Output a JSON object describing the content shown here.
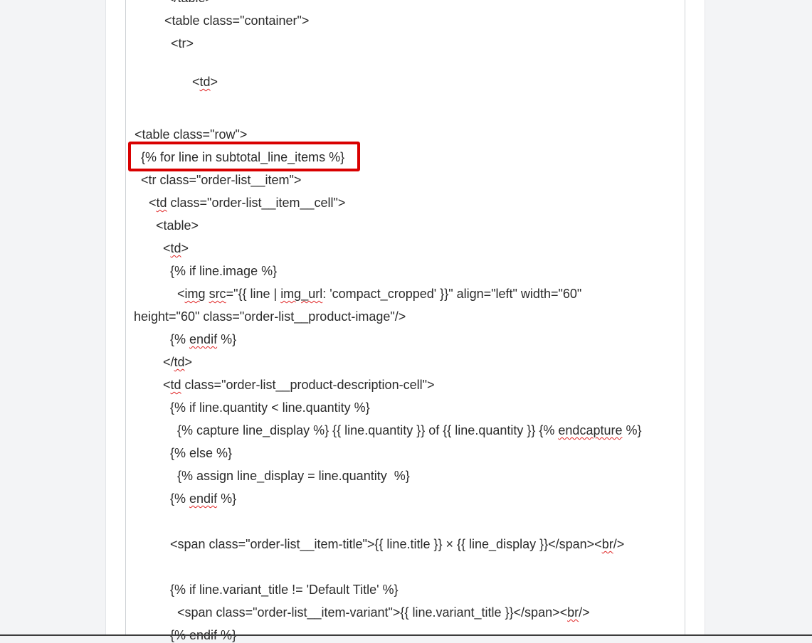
{
  "editor": {
    "lines": [
      "</table>",
      "<table class=\"container\">",
      "  <tr>",
      "    <td>",
      "",
      "",
      "<table class=\"row\">",
      "  {% for line in subtotal_line_items %}",
      "  <tr class=\"order-list__item\">",
      "    <td class=\"order-list__item__cell\">",
      "      <table>",
      "        <td>",
      "          {% if line.image %}",
      "            <img src=\"{{ line | img_url: 'compact_cropped' }}\" align=\"left\" width=\"60\"",
      "height=\"60\" class=\"order-list__product-image\"/>",
      "          {% endif %}",
      "        </td>",
      "        <td class=\"order-list__product-description-cell\">",
      "          {% if line.quantity < line.quantity %}",
      "            {% capture line_display %} {{ line.quantity }} of {{ line.quantity }} {% endcapture %}",
      "          {% else %}",
      "            {% assign line_display = line.quantity  %}",
      "          {% endif %}",
      "",
      "          <span class=\"order-list__item-title\">{{ line.title }} × {{ line_display }}</span><br/>",
      "",
      "          {% if line.variant_title != 'Default Title' %}",
      "            <span class=\"order-list__item-variant\">{{ line.variant_title }}</span><br/>",
      "          {% endif %}"
    ],
    "highlighted_line": "  {% for line in subtotal_line_items %}",
    "highlight_color": "#d90000",
    "squiggle_color": "#e02424"
  }
}
